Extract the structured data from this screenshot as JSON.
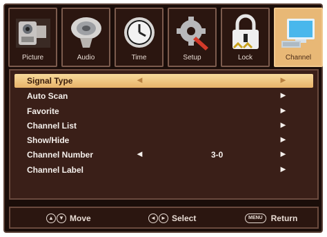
{
  "tabs": [
    {
      "label": "Picture",
      "icon": "camera-icon"
    },
    {
      "label": "Audio",
      "icon": "speaker-icon"
    },
    {
      "label": "Time",
      "icon": "clock-icon"
    },
    {
      "label": "Setup",
      "icon": "gear-icon"
    },
    {
      "label": "Lock",
      "icon": "lock-icon"
    },
    {
      "label": "Channel",
      "icon": "computer-monitor-icon",
      "active": true
    }
  ],
  "items": [
    {
      "label": "Signal Type",
      "highlighted": true
    },
    {
      "label": "Auto Scan"
    },
    {
      "label": "Favorite"
    },
    {
      "label": "Channel List"
    },
    {
      "label": "Show/Hide"
    },
    {
      "label": "Channel Number",
      "value": "3-0"
    },
    {
      "label": "Channel Label"
    }
  ],
  "footer": {
    "move": "Move",
    "select": "Select",
    "menu_key": "MENU",
    "return": "Return"
  },
  "colors": {
    "background": "#1a0d09",
    "panel": "#3a1f18",
    "highlight": "#e8b36a",
    "active_tab": "#e8b876"
  }
}
